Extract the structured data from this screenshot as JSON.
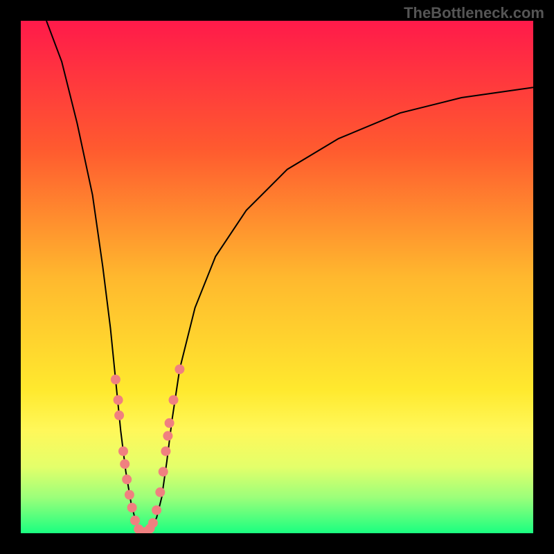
{
  "watermark": "TheBottleneck.com",
  "chart_data": {
    "type": "line",
    "title": "",
    "xlabel": "",
    "ylabel": "",
    "xlim": [
      0,
      100
    ],
    "ylim": [
      0,
      100
    ],
    "gradient": {
      "stops": [
        {
          "offset": 0,
          "color": "#ff1a4a"
        },
        {
          "offset": 25,
          "color": "#ff5a2f"
        },
        {
          "offset": 50,
          "color": "#ffb82e"
        },
        {
          "offset": 72,
          "color": "#ffe92e"
        },
        {
          "offset": 80,
          "color": "#fff85a"
        },
        {
          "offset": 87,
          "color": "#e4ff6a"
        },
        {
          "offset": 93,
          "color": "#9cff7a"
        },
        {
          "offset": 100,
          "color": "#1aff80"
        }
      ]
    },
    "curve": [
      {
        "x": 5,
        "y": 100
      },
      {
        "x": 8,
        "y": 92
      },
      {
        "x": 11,
        "y": 80
      },
      {
        "x": 14,
        "y": 66
      },
      {
        "x": 16,
        "y": 52
      },
      {
        "x": 17.5,
        "y": 40
      },
      {
        "x": 18.5,
        "y": 30
      },
      {
        "x": 19.5,
        "y": 20
      },
      {
        "x": 20.5,
        "y": 12
      },
      {
        "x": 21.5,
        "y": 6
      },
      {
        "x": 22.5,
        "y": 2
      },
      {
        "x": 23.5,
        "y": 0
      },
      {
        "x": 25,
        "y": 0.5
      },
      {
        "x": 26.5,
        "y": 3
      },
      {
        "x": 27.5,
        "y": 7
      },
      {
        "x": 28.5,
        "y": 14
      },
      {
        "x": 29.5,
        "y": 22
      },
      {
        "x": 31,
        "y": 32
      },
      {
        "x": 34,
        "y": 44
      },
      {
        "x": 38,
        "y": 54
      },
      {
        "x": 44,
        "y": 63
      },
      {
        "x": 52,
        "y": 71
      },
      {
        "x": 62,
        "y": 77
      },
      {
        "x": 74,
        "y": 82
      },
      {
        "x": 86,
        "y": 85
      },
      {
        "x": 100,
        "y": 87
      }
    ],
    "markers": [
      {
        "x": 18.5,
        "y": 30
      },
      {
        "x": 19,
        "y": 26
      },
      {
        "x": 19.2,
        "y": 23
      },
      {
        "x": 20,
        "y": 16
      },
      {
        "x": 20.3,
        "y": 13.5
      },
      {
        "x": 20.7,
        "y": 10.5
      },
      {
        "x": 21.2,
        "y": 7.5
      },
      {
        "x": 21.7,
        "y": 5
      },
      {
        "x": 22.3,
        "y": 2.5
      },
      {
        "x": 23,
        "y": 0.8
      },
      {
        "x": 23.8,
        "y": 0.2
      },
      {
        "x": 24.5,
        "y": 0.3
      },
      {
        "x": 25.2,
        "y": 0.9
      },
      {
        "x": 25.8,
        "y": 2
      },
      {
        "x": 26.5,
        "y": 4.5
      },
      {
        "x": 27.2,
        "y": 8
      },
      {
        "x": 27.8,
        "y": 12
      },
      {
        "x": 28.3,
        "y": 16
      },
      {
        "x": 28.7,
        "y": 19
      },
      {
        "x": 29,
        "y": 21.5
      },
      {
        "x": 29.8,
        "y": 26
      },
      {
        "x": 31,
        "y": 32
      }
    ],
    "marker_color": "#f08080",
    "curve_color": "#000000"
  }
}
